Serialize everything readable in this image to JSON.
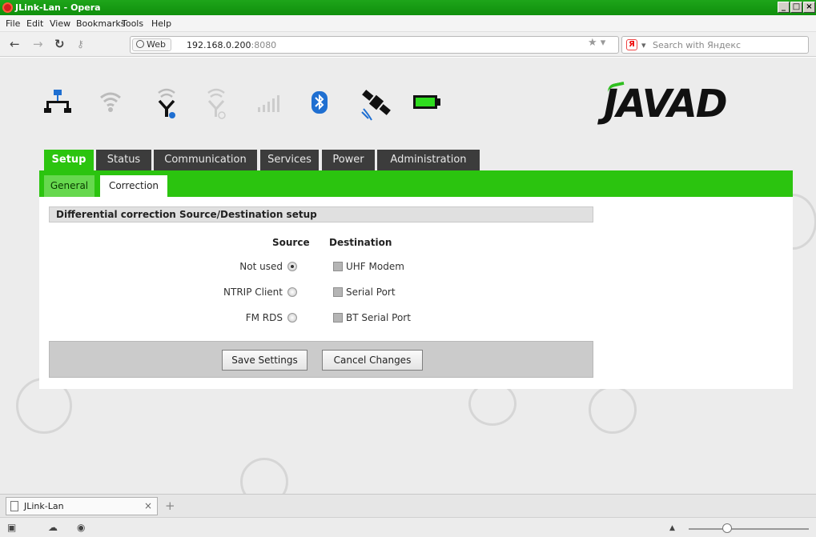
{
  "window": {
    "title": "JLink-Lan - Opera"
  },
  "menu": [
    "File",
    "Edit",
    "View",
    "Bookmarks",
    "Tools",
    "Help"
  ],
  "address_bar": {
    "web_badge": "Web",
    "url_host": "192.168.0.200",
    "url_port": ":8080",
    "search_placeholder": "Search with Яндекс"
  },
  "brand": "JAVAD",
  "status_icons": [
    "network-icon",
    "wifi-icon",
    "antenna-icon",
    "antenna-off-icon",
    "signal-bars-icon",
    "bluetooth-icon",
    "satellite-icon",
    "battery-icon"
  ],
  "tabs": [
    "Setup",
    "Status",
    "Communication",
    "Services",
    "Power",
    "Administration"
  ],
  "subtabs": [
    "General",
    "Correction"
  ],
  "section_title": "Differential correction Source/Destination setup",
  "columns": {
    "source": "Source",
    "destination": "Destination"
  },
  "rows": [
    {
      "source": "Not used",
      "selected": true,
      "destination": "UHF Modem"
    },
    {
      "source": "NTRIP Client",
      "selected": false,
      "destination": "Serial Port"
    },
    {
      "source": "FM RDS",
      "selected": false,
      "destination": "BT Serial Port"
    }
  ],
  "buttons": {
    "save": "Save Settings",
    "cancel": "Cancel Changes"
  },
  "browser_tab": {
    "label": "JLink-Lan",
    "close": "×",
    "new_tab": "+"
  }
}
